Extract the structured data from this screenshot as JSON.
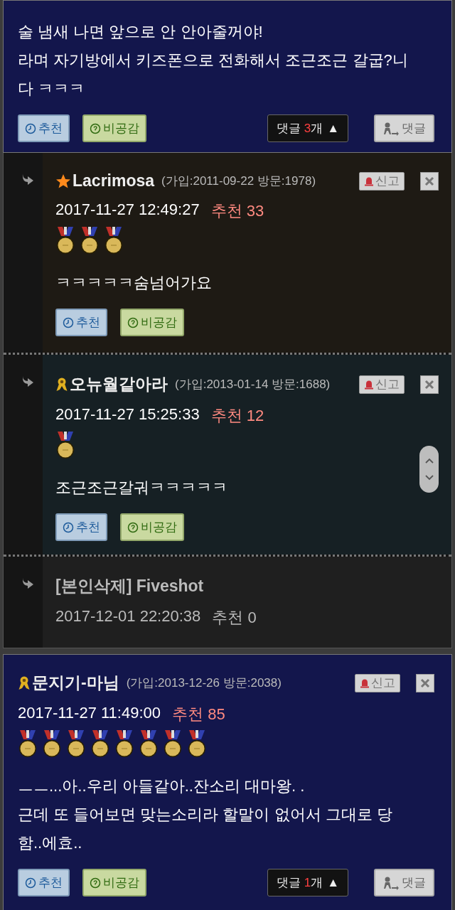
{
  "post": {
    "body": [
      "술 냄새 나면 앞으로 안 안아줄꺼야!",
      "라며 자기방에서 키즈폰으로 전화해서 조근조근 갈굽?니다 ㅋㅋㅋ"
    ],
    "actions": {
      "recommend": "추천",
      "disagree": "비공감",
      "reply_count": {
        "prefix": "댓글 ",
        "count": "3",
        "suffix": "개",
        "toggle": "▲"
      },
      "reply": "댓글"
    }
  },
  "replies": [
    {
      "kind": "comment",
      "badge": {
        "kind": "star"
      },
      "author": "Lacrimosa",
      "meta": "(가입:2011-09-22 방문:1978)",
      "report": "신고",
      "date": "2017-11-27 12:49:27",
      "recommend_count": "추천 33",
      "medals": [
        {
          "kind": "gold"
        },
        {
          "kind": "gold"
        },
        {
          "kind": "gold"
        }
      ],
      "body": [
        "ㅋㅋㅋㅋㅋ숨넘어가요"
      ],
      "actions": {
        "recommend": "추천",
        "disagree": "비공감"
      }
    },
    {
      "kind": "comment",
      "badge": {
        "kind": "ribbon"
      },
      "author": "오뉴월같아라",
      "meta": "(가입:2013-01-14 방문:1688)",
      "report": "신고",
      "date": "2017-11-27 15:25:33",
      "recommend_count": "추천 12",
      "medals": [
        {
          "kind": "gold"
        }
      ],
      "body": [
        "조근조근갈궈ㅋㅋㅋㅋㅋ"
      ],
      "actions": {
        "recommend": "추천",
        "disagree": "비공감"
      }
    },
    {
      "kind": "deleted",
      "author": "[본인삭제] Fiveshot",
      "date": "2017-12-01 22:20:38",
      "recommend_count": "추천 0"
    }
  ],
  "next_post": {
    "badge": {
      "kind": "ribbon"
    },
    "author": "문지기-마님",
    "meta": "(가입:2013-12-26 방문:2038)",
    "report": "신고",
    "date": "2017-11-27 11:49:00",
    "recommend_count": "추천 85",
    "medals": [
      {
        "kind": "gold"
      },
      {
        "kind": "gold"
      },
      {
        "kind": "gold"
      },
      {
        "kind": "gold"
      },
      {
        "kind": "gold"
      },
      {
        "kind": "gold"
      },
      {
        "kind": "gold"
      },
      {
        "kind": "gold"
      }
    ],
    "body": [
      "ㅡㅡ...아..우리 아들같아..잔소리 대마왕. .",
      "근데 또 들어보면 맞는소리라 할말이 없어서 그대로 당함..에효.."
    ],
    "actions": {
      "recommend": "추천",
      "disagree": "비공감",
      "reply_count": {
        "prefix": "댓글 ",
        "count": "1",
        "suffix": "개",
        "toggle": "▲"
      },
      "reply": "댓글"
    }
  }
}
